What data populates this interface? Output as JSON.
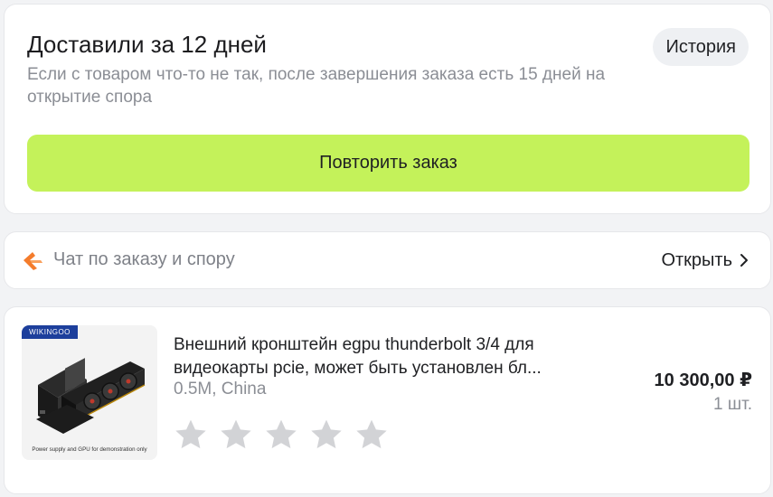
{
  "delivery": {
    "title": "Доставили за 12 дней",
    "subtitle": "Если с товаром что-то не так, после завершения заказа есть 15 дней на открытие спора",
    "history_label": "История",
    "repeat_label": "Повторить заказ",
    "accent_color": "#c4f25a"
  },
  "chat": {
    "icon": "chat-logo-icon",
    "label": "Чат по заказу и спору",
    "open_label": "Открыть",
    "open_icon": "chevron-right-icon"
  },
  "product": {
    "brand_tag": "WIKINGOO",
    "image_caption": "Power supply and GPU for demonstration only",
    "title": "Внешний кронштейн egpu thunderbolt 3/4 для видеокарты pcie, может быть установлен бл...",
    "variant": "0.5M, China",
    "price": "10 300,00 ₽",
    "quantity": "1 шт.",
    "rating": {
      "max": 5,
      "value": 0,
      "icon": "star-icon",
      "empty_color": "#d2d3d6"
    }
  }
}
